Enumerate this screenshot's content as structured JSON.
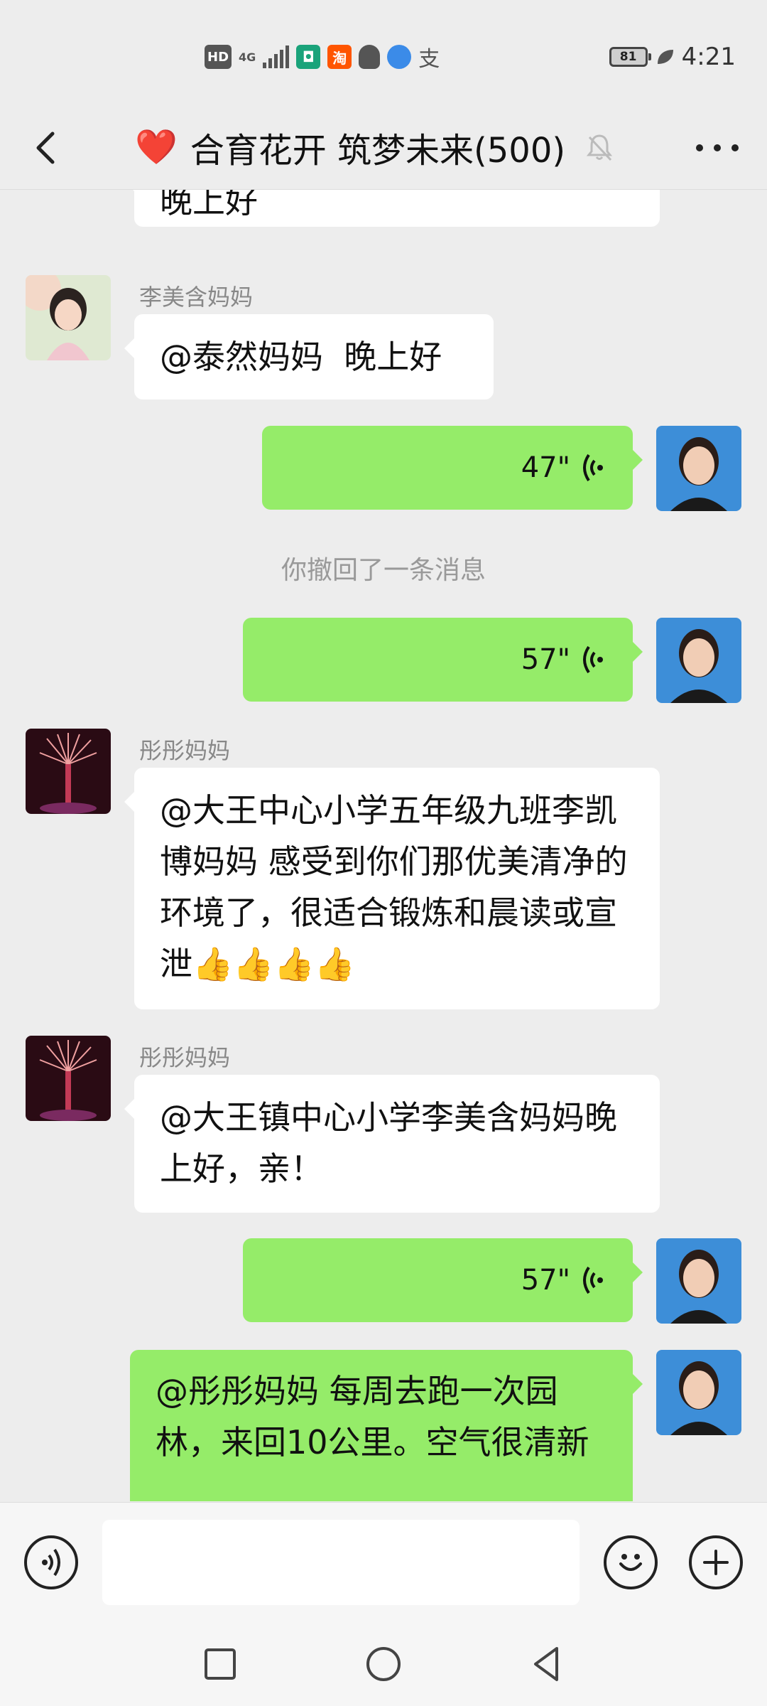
{
  "status_bar": {
    "left_icons": [
      "HD",
      "4G",
      "signal-icon",
      "mi-icon",
      "淘",
      "qq-icon",
      "browser-icon",
      "支"
    ],
    "battery": "81",
    "time": "4:21"
  },
  "header": {
    "emoji": "❤️",
    "title": "合育花开 筑梦未来(500)"
  },
  "messages": [
    {
      "side": "in",
      "text": "晚上好"
    },
    {
      "side": "in",
      "sender": "李美含妈妈",
      "text": "@泰然妈妈  晚上好"
    },
    {
      "side": "out",
      "type": "voice",
      "duration": "47\""
    },
    {
      "side": "system",
      "text": "你撤回了一条消息"
    },
    {
      "side": "out",
      "type": "voice",
      "duration": "57\""
    },
    {
      "side": "in",
      "sender": "彤彤妈妈",
      "text": "@大王中心小学五年级九班李凯博妈妈  感受到你们那优美清净的环境了，很适合锻炼和晨读或宣泄👍👍👍👍"
    },
    {
      "side": "in",
      "sender": "彤彤妈妈",
      "text": "@大王镇中心小学李美含妈妈晚上好，亲！"
    },
    {
      "side": "out",
      "type": "voice",
      "duration": "57\""
    },
    {
      "side": "out",
      "text": "@彤彤妈妈  每周去跑一次园林，来回10公里。空气很清新"
    }
  ],
  "colors": {
    "background": "#ededed",
    "outgoing_bubble": "#95ec69",
    "incoming_bubble": "#ffffff",
    "heart": "#e0202a"
  }
}
